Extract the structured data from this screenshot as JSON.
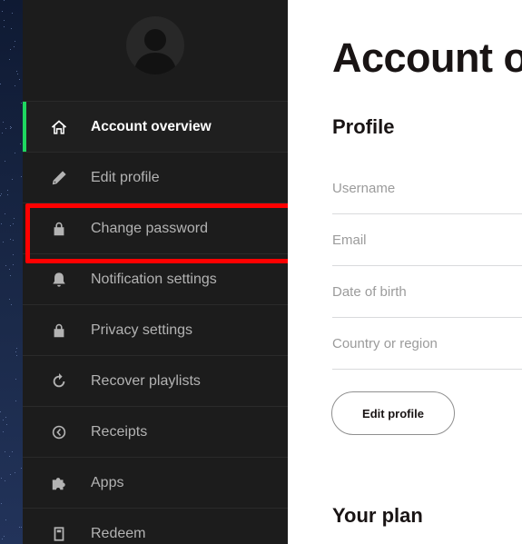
{
  "sidebar": {
    "avatar": "user-avatar",
    "accent_color": "#1ed760",
    "items": [
      {
        "label": "Account overview",
        "icon": "home-icon",
        "active": true
      },
      {
        "label": "Edit profile",
        "icon": "pencil-icon"
      },
      {
        "label": "Change password",
        "icon": "lock-icon",
        "highlighted": true
      },
      {
        "label": "Notification settings",
        "icon": "bell-icon"
      },
      {
        "label": "Privacy settings",
        "icon": "lock-icon"
      },
      {
        "label": "Recover playlists",
        "icon": "refresh-icon"
      },
      {
        "label": "Receipts",
        "icon": "clock-icon"
      },
      {
        "label": "Apps",
        "icon": "puzzle-icon"
      },
      {
        "label": "Redeem",
        "icon": "gift-card-icon"
      }
    ]
  },
  "annotation": {
    "color": "#ff0000"
  },
  "main": {
    "title": "Account o",
    "profile_heading": "Profile",
    "fields": [
      "Username",
      "Email",
      "Date of birth",
      "Country or region"
    ],
    "edit_button": "Edit profile",
    "plan_heading": "Your plan"
  }
}
